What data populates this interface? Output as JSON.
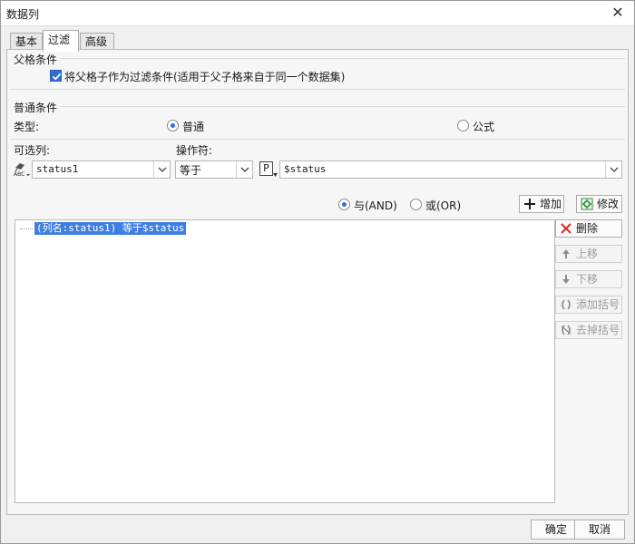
{
  "window": {
    "title": "数据列",
    "close_glyph": "✕"
  },
  "tabs": [
    {
      "label": "基本",
      "active": false
    },
    {
      "label": "过滤",
      "active": true
    },
    {
      "label": "高级",
      "active": false
    }
  ],
  "parent_condition": {
    "section_title": "父格条件",
    "checkbox_label": "将父格子作为过滤条件(适用于父子格来自于同一个数据集)",
    "checked": true
  },
  "normal_condition": {
    "section_title": "普通条件",
    "type_label": "类型:",
    "type_options": [
      {
        "label": "普通",
        "selected": true
      },
      {
        "label": "公式",
        "selected": false
      }
    ],
    "column_label": "可选列:",
    "operator_label": "操作符:",
    "column_value": "status1",
    "operator_value": "等于",
    "param_badge": "P",
    "value_text": "$status"
  },
  "logic": {
    "and_label": "与(AND)",
    "or_label": "或(OR)",
    "and_selected": true
  },
  "actions": {
    "add_label": "增加",
    "modify_label": "修改"
  },
  "condition_list": [
    "(列名:status1) 等于$status"
  ],
  "side_buttons": {
    "delete_label": "删除",
    "move_up_label": "上移",
    "move_down_label": "下移",
    "add_bracket_label": "添加括号",
    "remove_bracket_label": "去掉括号"
  },
  "footer": {
    "ok_label": "确定",
    "cancel_label": "取消"
  },
  "colors": {
    "accent": "#2f6fd4",
    "selection": "#3f7fe0",
    "delete_red": "#d9322c",
    "add_green": "#2e8b3a"
  },
  "icons": {
    "close": "close-icon",
    "checkbox": "checkmark-icon",
    "column_type": "abc-column-icon",
    "dropdown": "chevron-down-icon",
    "add": "plus-icon",
    "modify": "edit-gear-icon",
    "delete": "red-x-icon",
    "up": "arrow-up-icon",
    "down": "arrow-down-icon",
    "add_bracket": "parentheses-icon",
    "remove_bracket": "remove-parentheses-icon"
  }
}
